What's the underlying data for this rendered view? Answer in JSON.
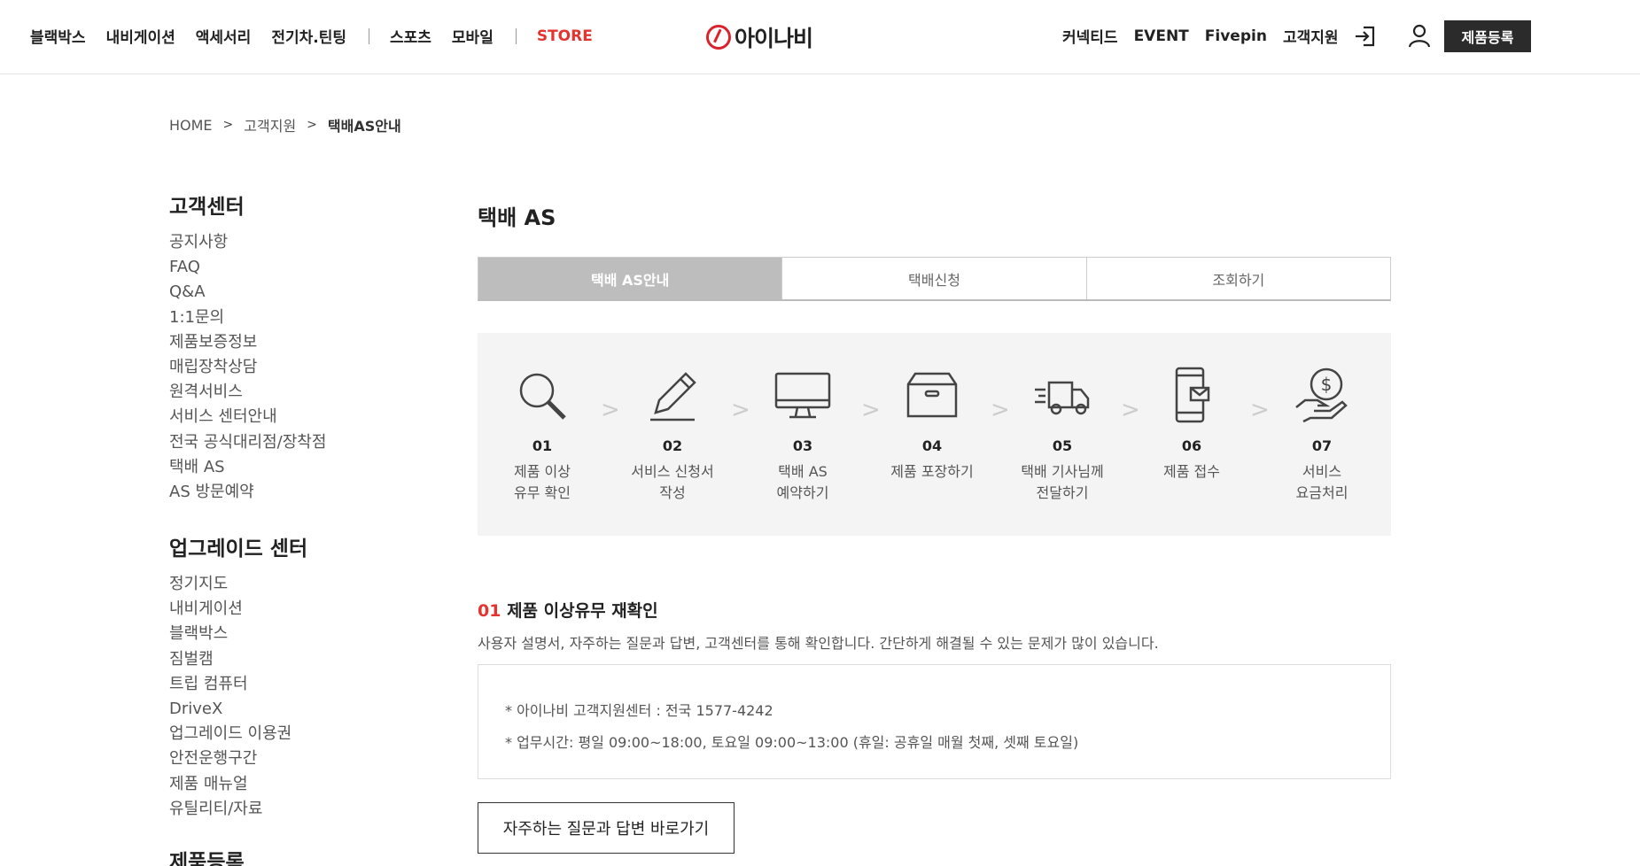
{
  "header": {
    "nav_left": [
      "블랙박스",
      "내비게이션",
      "액세서리",
      "전기차.틴팅"
    ],
    "nav_left2": [
      "스포츠",
      "모바일"
    ],
    "store": "STORE",
    "logo": "아이나비",
    "nav_right": [
      "커넥티드",
      "EVENT",
      "Fivepin",
      "고객지원"
    ],
    "register_button": "제품등록",
    "icons": [
      "login-icon",
      "user-icon"
    ],
    "accent_color": "#e3342f"
  },
  "breadcrumb": {
    "home": "HOME",
    "level1": "고객지원",
    "current": "택배AS안내"
  },
  "sidebar": {
    "group1_title": "고객센터",
    "group1_items": [
      "공지사항",
      "FAQ",
      "Q&A",
      "1:1문의",
      "제품보증정보",
      "매립장착상담",
      "원격서비스",
      "서비스 센터안내",
      "전국 공식대리점/장착점",
      "택배 AS",
      "AS 방문예약"
    ],
    "group2_title": "업그레이드 센터",
    "group2_items": [
      "정기지도",
      "내비게이션",
      "블랙박스",
      "짐벌캠",
      "트립 컴퓨터",
      "DriveX",
      "업그레이드 이용권",
      "안전운행구간",
      "제품 매뉴얼",
      "유틸리티/자료"
    ],
    "group3_title": "제품등록"
  },
  "main": {
    "title": "택배 AS",
    "tabs": [
      "택배 AS안내",
      "택배신청",
      "조회하기"
    ],
    "active_tab": "택배 AS안내",
    "steps": [
      {
        "num": "01",
        "label": "제품 이상\n유무 확인",
        "icon": "search-icon"
      },
      {
        "num": "02",
        "label": "서비스 신청서\n작성",
        "icon": "pencil-icon"
      },
      {
        "num": "03",
        "label": "택배 AS\n예약하기",
        "icon": "monitor-icon"
      },
      {
        "num": "04",
        "label": "제품 포장하기",
        "icon": "box-icon"
      },
      {
        "num": "05",
        "label": "택배 기사님께\n전달하기",
        "icon": "truck-icon"
      },
      {
        "num": "06",
        "label": "제품 접수",
        "icon": "phone-mail-icon"
      },
      {
        "num": "07",
        "label": "서비스\n요금처리",
        "icon": "money-hand-icon"
      }
    ],
    "section_num": "01",
    "section_title": "제품 이상유무 재확인",
    "section_desc": "사용자 설명서, 자주하는 질문과 답변, 고객센터를 통해 확인합니다. 간단하게 해결될 수 있는 문제가 많이 있습니다.",
    "info_lines": [
      "* 아이나비 고객지원센터 : 전국 1577-4242",
      "* 업무시간: 평일 09:00~18:00, 토요일 09:00~13:00 (휴일: 공휴일 매월 첫째, 셋째 토요일)"
    ],
    "faq_button": "자주하는 질문과 답변 바로가기"
  }
}
